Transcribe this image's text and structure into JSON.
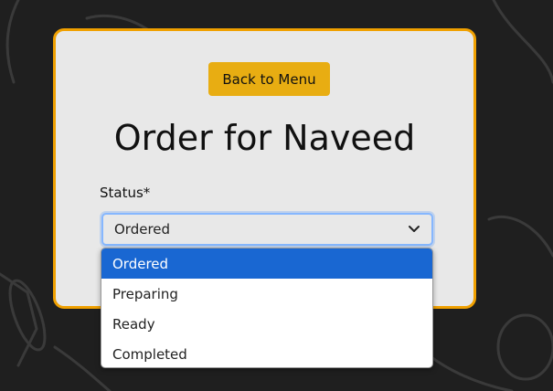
{
  "back_button": {
    "label": "Back to Menu"
  },
  "heading": "Order for Naveed",
  "status_field": {
    "label": "Status*",
    "selected": "Ordered",
    "options": [
      "Ordered",
      "Preparing",
      "Ready",
      "Completed"
    ]
  },
  "colors": {
    "accent": "#e8ad12",
    "card_border": "#f0a000",
    "selected_option": "#1967d2",
    "background": "#1f1f1f"
  }
}
